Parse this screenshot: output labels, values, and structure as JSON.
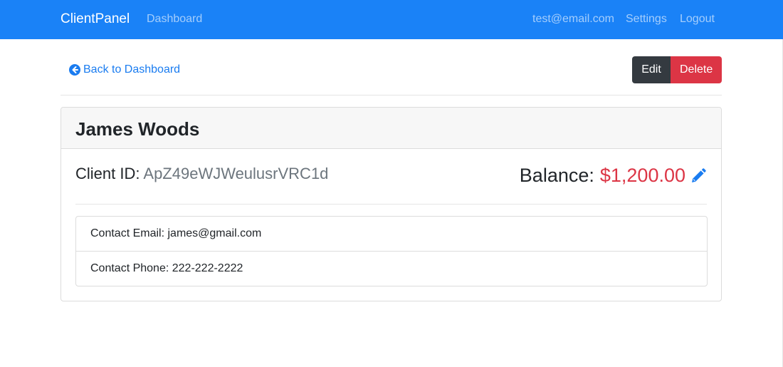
{
  "navbar": {
    "brand": "ClientPanel",
    "dashboard_link": "Dashboard",
    "user_email": "test@email.com",
    "settings_link": "Settings",
    "logout_link": "Logout",
    "bg_color": "#1a82f7"
  },
  "toolbar": {
    "back_label": "Back to Dashboard",
    "back_icon": "arrow-circle-left-icon",
    "edit_label": "Edit",
    "delete_label": "Delete"
  },
  "client": {
    "name": "James Woods",
    "id_label": "Client ID:",
    "id_value": "ApZ49eWJWeulusrVRC1d",
    "balance_label": "Balance:",
    "balance_value": "$1,200.00",
    "balance_edit_icon": "pencil-icon",
    "contact_email": "Contact Email: james@gmail.com",
    "contact_phone": "Contact Phone: 222-222-2222"
  },
  "colors": {
    "primary": "#1a7cf0",
    "danger": "#dc3545",
    "dark": "#343a40",
    "muted": "#6c757d"
  }
}
